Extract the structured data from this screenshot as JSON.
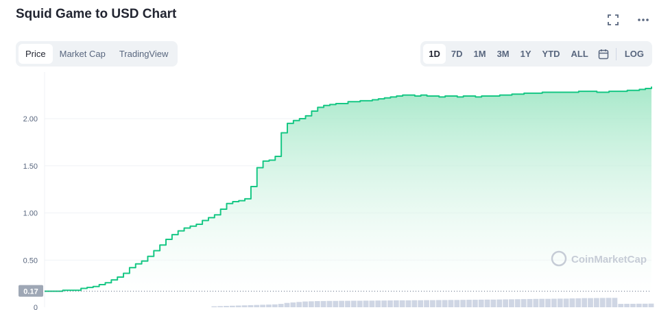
{
  "header": {
    "title": "Squid Game to USD Chart"
  },
  "icons": {
    "fullscreen": "fullscreen-icon",
    "more": "more-icon",
    "calendar": "calendar-icon"
  },
  "tabs_left": [
    "Price",
    "Market Cap",
    "TradingView"
  ],
  "tabs_left_active": "Price",
  "ranges": [
    "1D",
    "7D",
    "1M",
    "3M",
    "1Y",
    "YTD",
    "ALL"
  ],
  "ranges_active": "1D",
  "log_label": "LOG",
  "colors": {
    "line": "#16c784",
    "fill_top": "#9ee6c4",
    "volume": "#cfd6e4",
    "current_badge": "#9ea7b5"
  },
  "watermark": "CoinMarketCap",
  "chart_data": {
    "type": "area",
    "ylim": [
      0,
      2.4
    ],
    "yticks": [
      "0",
      "0.50",
      "1.00",
      "1.50",
      "2.00"
    ],
    "current_price_label": "0.17",
    "grid": true,
    "x": [
      0,
      1,
      2,
      3,
      4,
      5,
      6,
      7,
      8,
      9,
      10,
      11,
      12,
      13,
      14,
      15,
      16,
      17,
      18,
      19,
      20,
      21,
      22,
      23,
      24,
      25,
      26,
      27,
      28,
      29,
      30,
      31,
      32,
      33,
      34,
      35,
      36,
      37,
      38,
      39,
      40,
      41,
      42,
      43,
      44,
      45,
      46,
      47,
      48,
      49,
      50,
      51,
      52,
      53,
      54,
      55,
      56,
      57,
      58,
      59,
      60,
      61,
      62,
      63,
      64,
      65,
      66,
      67,
      68,
      69,
      70,
      71,
      72,
      73,
      74,
      75,
      76,
      77,
      78,
      79,
      80,
      81,
      82,
      83,
      84,
      85,
      86,
      87,
      88,
      89,
      90,
      91,
      92,
      93,
      94,
      95,
      96,
      97,
      98,
      99,
      100
    ],
    "values": [
      0.17,
      0.17,
      0.17,
      0.18,
      0.18,
      0.18,
      0.2,
      0.21,
      0.22,
      0.24,
      0.26,
      0.29,
      0.32,
      0.36,
      0.42,
      0.46,
      0.49,
      0.54,
      0.6,
      0.66,
      0.72,
      0.77,
      0.81,
      0.84,
      0.86,
      0.88,
      0.92,
      0.95,
      0.98,
      1.04,
      1.1,
      1.12,
      1.13,
      1.15,
      1.28,
      1.48,
      1.55,
      1.56,
      1.6,
      1.85,
      1.95,
      1.98,
      2.0,
      2.03,
      2.08,
      2.12,
      2.14,
      2.15,
      2.16,
      2.16,
      2.18,
      2.18,
      2.19,
      2.19,
      2.2,
      2.21,
      2.22,
      2.23,
      2.24,
      2.25,
      2.25,
      2.24,
      2.25,
      2.24,
      2.24,
      2.23,
      2.24,
      2.24,
      2.23,
      2.24,
      2.24,
      2.23,
      2.24,
      2.24,
      2.24,
      2.25,
      2.25,
      2.26,
      2.26,
      2.27,
      2.27,
      2.27,
      2.28,
      2.28,
      2.28,
      2.28,
      2.28,
      2.28,
      2.29,
      2.29,
      2.29,
      2.28,
      2.28,
      2.29,
      2.29,
      2.29,
      2.3,
      2.3,
      2.31,
      2.32,
      2.34
    ],
    "volume": [
      0,
      0,
      0,
      0,
      0,
      0,
      0,
      0,
      0,
      0,
      0,
      0,
      0,
      0,
      0,
      0,
      0,
      0,
      0,
      0,
      0,
      0,
      0,
      0,
      0,
      0,
      0,
      0,
      0.1,
      0.12,
      0.14,
      0.16,
      0.18,
      0.2,
      0.22,
      0.24,
      0.26,
      0.28,
      0.3,
      0.35,
      0.45,
      0.5,
      0.55,
      0.6,
      0.62,
      0.64,
      0.65,
      0.66,
      0.66,
      0.67,
      0.67,
      0.68,
      0.68,
      0.69,
      0.69,
      0.7,
      0.7,
      0.71,
      0.72,
      0.72,
      0.72,
      0.73,
      0.73,
      0.74,
      0.74,
      0.75,
      0.75,
      0.76,
      0.76,
      0.77,
      0.78,
      0.78,
      0.79,
      0.8,
      0.8,
      0.81,
      0.82,
      0.83,
      0.84,
      0.85,
      0.86,
      0.87,
      0.88,
      0.88,
      0.89,
      0.9,
      0.9,
      0.92,
      0.93,
      0.95,
      0.95,
      0.96,
      0.97,
      0.98,
      0.98,
      0.35,
      0.36,
      0.36,
      0.37,
      0.37,
      0.38
    ]
  }
}
